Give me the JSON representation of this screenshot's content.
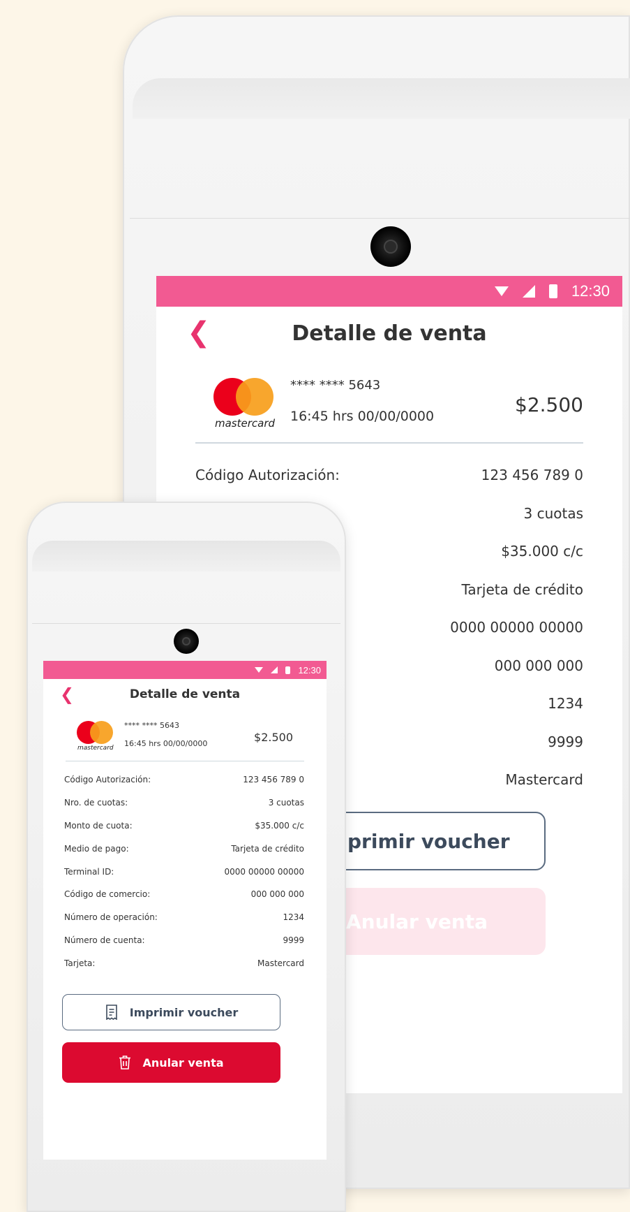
{
  "status_bar": {
    "time": "12:30"
  },
  "header": {
    "title": "Detalle de venta"
  },
  "sale": {
    "brand_logo_text": "mastercard",
    "card_number": "**** **** 5643",
    "datetime": "16:45 hrs  00/00/0000",
    "amount": "$2.500"
  },
  "details": [
    {
      "label": "Código Autorización:",
      "value": "123 456 789 0"
    },
    {
      "label": "Nro. de cuotas:",
      "value": "3 cuotas"
    },
    {
      "label": "Monto de cuota:",
      "value": "$35.000 c/c"
    },
    {
      "label": "Medio de pago:",
      "value": "Tarjeta de crédito"
    },
    {
      "label": "Terminal ID:",
      "value": "0000 00000 00000"
    },
    {
      "label": "Código de comercio:",
      "value": "000 000 000"
    },
    {
      "label": "Número de operación:",
      "value": "1234"
    },
    {
      "label": "Número de cuenta:",
      "value": "9999"
    },
    {
      "label": "Tarjeta:",
      "value": "Mastercard"
    }
  ],
  "large_partial": {
    "op_label_fragment": "n:",
    "print_fragment": "primir voucher",
    "cancel_fragment": "Anular venta"
  },
  "actions": {
    "print_label": "Imprimir voucher",
    "cancel_label": "Anular venta"
  },
  "colors": {
    "status_bar": "#f25a92",
    "accent": "#e8336e",
    "danger": "#dc0a30",
    "outline": "#5a6b80"
  },
  "icons": {
    "back": "chevron-left-icon",
    "print": "receipt-icon",
    "cancel": "trash-icon",
    "wifi": "wifi-icon",
    "signal": "signal-icon",
    "battery": "battery-icon"
  }
}
